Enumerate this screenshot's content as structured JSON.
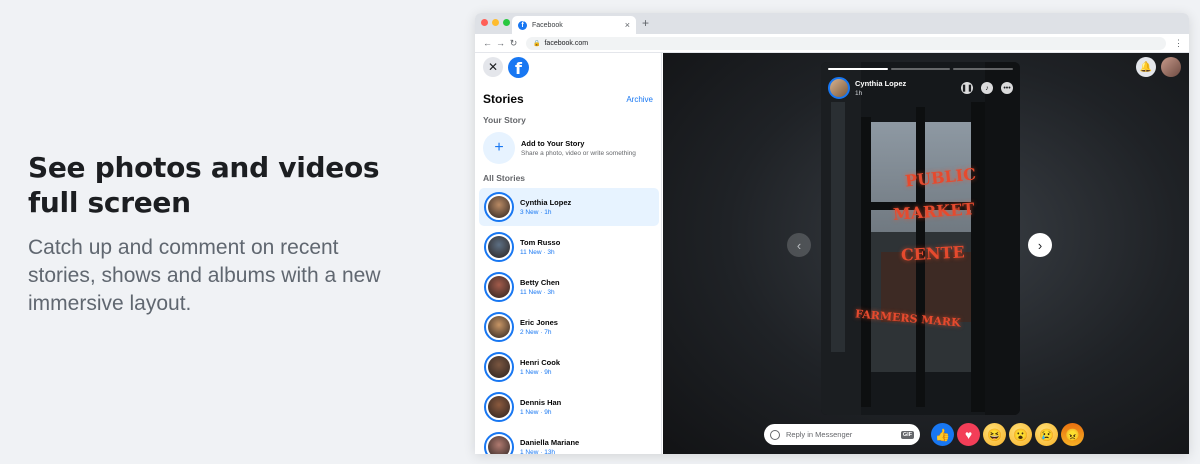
{
  "promo": {
    "headline_line1": "See photos and videos",
    "headline_line2": "full screen",
    "body": "Catch up and comment on recent stories, shows and albums with a new immersive layout."
  },
  "browser": {
    "tab_title": "Facebook",
    "url": "facebook.com"
  },
  "sidebar": {
    "title": "Stories",
    "archive_label": "Archive",
    "your_story_label": "Your Story",
    "add_story_title": "Add to Your Story",
    "add_story_sub": "Share a photo, video or write something",
    "all_stories_label": "All Stories",
    "stories": [
      {
        "name": "Cynthia Lopez",
        "meta": "3 New · 1h",
        "active": true,
        "tone": "#b98a64"
      },
      {
        "name": "Tom Russo",
        "meta": "11 New · 3h",
        "active": false,
        "tone": "#5d6f83"
      },
      {
        "name": "Betty Chen",
        "meta": "11 New · 3h",
        "active": false,
        "tone": "#a25b4b"
      },
      {
        "name": "Eric Jones",
        "meta": "2 New · 7h",
        "active": false,
        "tone": "#c79565"
      },
      {
        "name": "Henri Cook",
        "meta": "1 New · 9h",
        "active": false,
        "tone": "#7a5640"
      },
      {
        "name": "Dennis Han",
        "meta": "1 New · 9h",
        "active": false,
        "tone": "#8b5a3e"
      },
      {
        "name": "Daniella Mariane",
        "meta": "1 New · 13h",
        "active": false,
        "tone": "#b07a70"
      }
    ]
  },
  "viewer": {
    "card_name": "Cynthia Lopez",
    "card_time": "1h",
    "progress_total": 3,
    "progress_done": 1,
    "sign_line1": "PUBLIC",
    "sign_line2": "MARKET",
    "sign_line3": "CENTE",
    "sign_line4": "FARMERS MARK",
    "reply_placeholder": "Reply in Messenger",
    "gif_label": "GIF"
  }
}
